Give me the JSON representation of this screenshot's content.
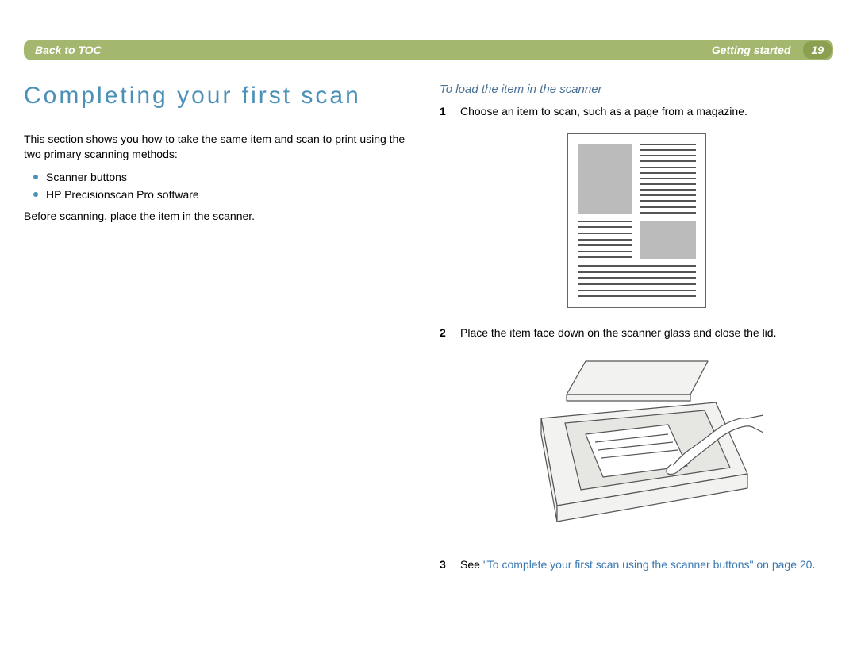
{
  "header": {
    "back_label": "Back to TOC",
    "section_label": "Getting started",
    "page_number": "19"
  },
  "left": {
    "title": "Completing your first scan",
    "intro": "This section shows you how to take the same item and scan to print using the two primary scanning methods:",
    "bullets": [
      "Scanner buttons",
      "HP Precisionscan Pro software"
    ],
    "before": "Before scanning, place the item in the scanner."
  },
  "right": {
    "subhead": "To load the item in the scanner",
    "steps": [
      {
        "n": "1",
        "text": "Choose an item to scan, such as a page from a magazine."
      },
      {
        "n": "2",
        "text": "Place the item face down on the scanner glass and close the lid."
      },
      {
        "n": "3",
        "prefix": "See ",
        "link": "\"To complete your first scan using the scanner buttons\" on page 20",
        "suffix": "."
      }
    ]
  }
}
